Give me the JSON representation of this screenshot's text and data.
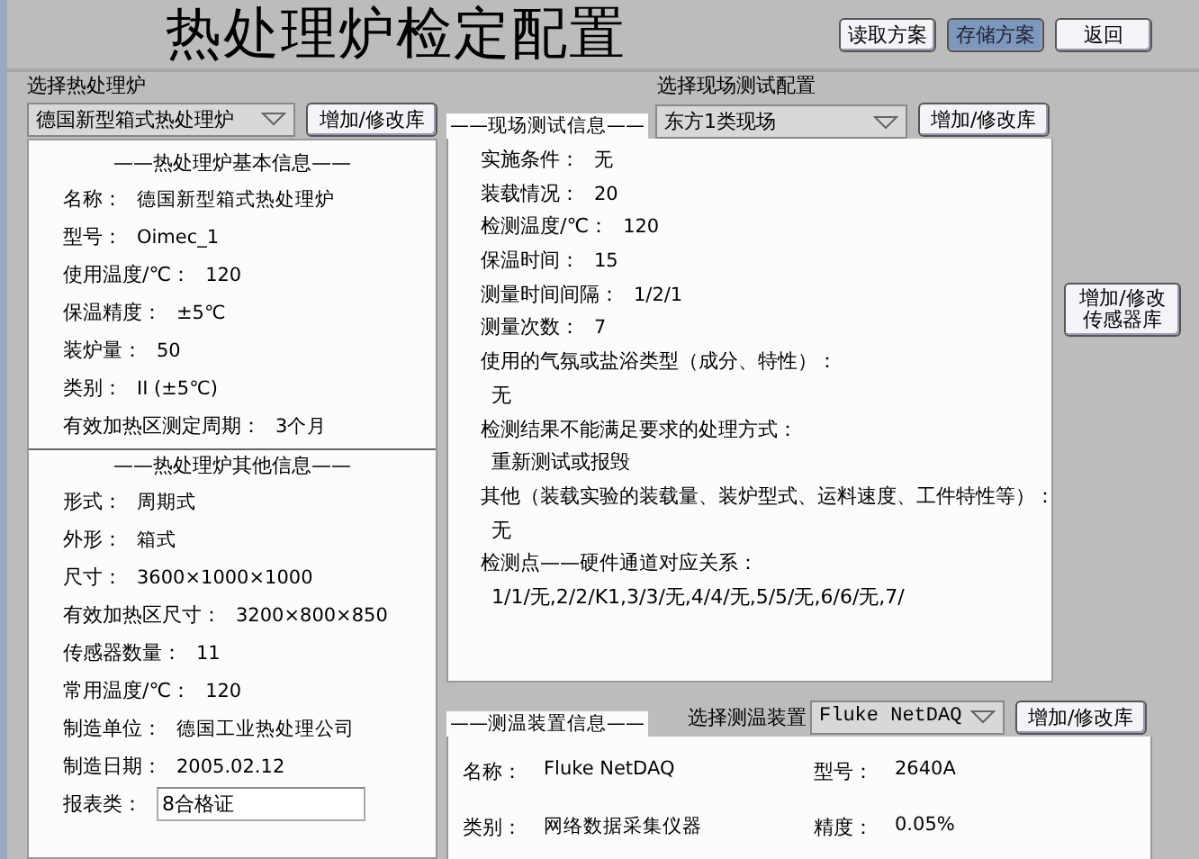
{
  "title": "热处理炉检定配置",
  "top_buttons": [
    {
      "label": "读取方案",
      "selected": false
    },
    {
      "label": "存储方案",
      "selected": true
    },
    {
      "label": "返回",
      "selected": false
    }
  ],
  "furnace": {
    "select_label": "选择热处理炉",
    "dropdown": "德国新型箱式热处理炉",
    "button": "增加/修改库",
    "sections": [
      {
        "heading": "——热处理炉基本信息——",
        "fields": [
          {
            "label": "名称：",
            "value": "德国新型箱式热处理炉"
          },
          {
            "label": "型号：",
            "value": "Oimec_1"
          },
          {
            "label": "使用温度/℃：",
            "value": "120"
          },
          {
            "label": "保温精度：",
            "value": "±5℃"
          },
          {
            "label": "装炉量：",
            "value": "50"
          },
          {
            "label": "类别：",
            "value": "II (±5℃)"
          },
          {
            "label": "有效加热区测定周期：",
            "value": "3个月"
          }
        ]
      },
      {
        "heading": "——热处理炉其他信息——",
        "fields": [
          {
            "label": "形式：",
            "value": "周期式"
          },
          {
            "label": "外形：",
            "value": "箱式"
          },
          {
            "label": "尺寸：",
            "value": "3600×1000×1000"
          },
          {
            "label": "有效加热区尺寸：",
            "value": "3200×800×850"
          },
          {
            "label": "传感器数量：",
            "value": "11"
          },
          {
            "label": "常用温度/℃：",
            "value": "120"
          },
          {
            "label": "制造单位：",
            "value": "德国工业热处理公司"
          },
          {
            "label": "制造日期：",
            "value": "2005.02.12"
          },
          {
            "label": "报表类：",
            "value": "8合格证",
            "kind": "input"
          }
        ]
      }
    ]
  },
  "site_test": {
    "select_label": "选择现场测试配置",
    "dropdown": "东方1类现场",
    "button": "增加/修改库",
    "legend": "——现场测试信息——",
    "lines": [
      {
        "kind": "field",
        "label": "实施条件：",
        "value": "无"
      },
      {
        "kind": "field",
        "label": "装载情况：",
        "value": "20"
      },
      {
        "kind": "field",
        "label": "检测温度/℃：",
        "value": "120"
      },
      {
        "kind": "field",
        "label": "保温时间：",
        "value": "15"
      },
      {
        "kind": "field",
        "label": "测量时间间隔：",
        "value": "1/2/1"
      },
      {
        "kind": "field",
        "label": "测量次数：",
        "value": "7"
      },
      {
        "kind": "question",
        "text": "使用的气氛或盐浴类型（成分、特性）："
      },
      {
        "kind": "answer",
        "text": "无"
      },
      {
        "kind": "question",
        "text": "检测结果不能满足要求的处理方式："
      },
      {
        "kind": "answer",
        "text": "重新测试或报毁"
      },
      {
        "kind": "question",
        "text": "其他（装载实验的装载量、装炉型式、运料速度、工件特性等）："
      },
      {
        "kind": "answer",
        "text": "无"
      },
      {
        "kind": "question",
        "text": "检测点——硬件通道对应关系："
      },
      {
        "kind": "answer",
        "text": "1/1/无,2/2/K1,3/3/无,4/4/无,5/5/无,6/6/无,7/"
      }
    ]
  },
  "sensor_button": [
    "增加/修改",
    "传感器库"
  ],
  "device": {
    "legend": "——测温装置信息——",
    "select_label": "选择测温装置",
    "dropdown": "Fluke NetDAQ",
    "button": "增加/修改库",
    "fields": [
      {
        "label": "名称：",
        "value": "Fluke NetDAQ"
      },
      {
        "label": "型号：",
        "value": "2640A"
      },
      {
        "label": "类别：",
        "value": "网络数据采集仪器"
      },
      {
        "label": "精度：",
        "value": "0.05%"
      }
    ]
  }
}
